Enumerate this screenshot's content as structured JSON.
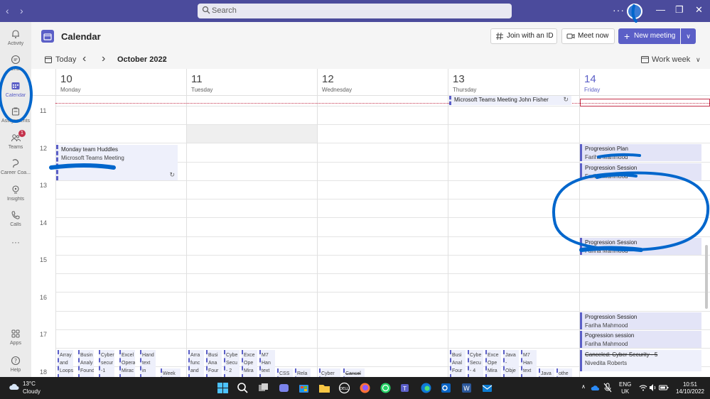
{
  "titlebar": {
    "search_placeholder": "Search",
    "more": "···"
  },
  "rail": [
    {
      "label": "Activity",
      "icon": "bell-icon",
      "active": false
    },
    {
      "label": "Chat",
      "icon": "chat-icon",
      "active": false
    },
    {
      "label": "Calendar",
      "icon": "calendar-icon",
      "active": true
    },
    {
      "label": "Assignments",
      "icon": "assignments-icon",
      "active": false
    },
    {
      "label": "Teams",
      "icon": "teams-icon",
      "active": false,
      "badge": "1"
    },
    {
      "label": "Career Coa...",
      "icon": "career-coach-icon",
      "active": false
    },
    {
      "label": "Insights",
      "icon": "insights-icon",
      "active": false
    },
    {
      "label": "Calls",
      "icon": "phone-icon",
      "active": false
    },
    {
      "label": "···",
      "icon": "more-icon",
      "active": false
    },
    {
      "label": "Apps",
      "icon": "apps-icon",
      "active": false
    },
    {
      "label": "Help",
      "icon": "help-icon",
      "active": false
    }
  ],
  "header": {
    "title": "Calendar",
    "join_id": "Join with an ID",
    "meet_now": "Meet now",
    "new_meeting": "New meeting"
  },
  "toolbar": {
    "today": "Today",
    "month": "October 2022",
    "view": "Work week"
  },
  "days": [
    {
      "num": "10",
      "name": "Monday"
    },
    {
      "num": "11",
      "name": "Tuesday"
    },
    {
      "num": "12",
      "name": "Wednesday"
    },
    {
      "num": "13",
      "name": "Thursday"
    },
    {
      "num": "14",
      "name": "Friday"
    }
  ],
  "hours": [
    "11",
    "12",
    "13",
    "14",
    "15",
    "16",
    "17",
    "18"
  ],
  "events": {
    "thu_teams": {
      "title": "Microsoft Teams Meeting  John Fisher"
    },
    "mon_huddle": {
      "title": "Monday team Huddles",
      "sub": "Microsoft Teams Meeting"
    },
    "fri_plan": {
      "title": "Progression Plan",
      "sub": "Fariha Mahmood"
    },
    "fri_session1": {
      "title": "Progression Session",
      "sub": "Fariha Mahmood"
    },
    "fri_session2": {
      "title": "Progression Session",
      "sub": "Fariha Mahmood"
    },
    "fri_session3": {
      "title": "Progression Session",
      "sub": "Fariha Mahmood"
    },
    "fri_pogression": {
      "title": "Pogression session",
      "sub": "Fariha Mahmood"
    },
    "fri_cancel": {
      "title": "Canceled: Cyber Security - 5",
      "sub": "Nivedita Roberts"
    }
  },
  "mini_events": {
    "mon": [
      "Array and Loops",
      "Busin Analy Found",
      "Cyber secur -1",
      "Excel Opera Mirac",
      "Hand text in",
      "Week"
    ],
    "tue": [
      "Arra func and",
      "Busi Ana Four",
      "Cybe Secu - 2",
      "Exce Ope Mira",
      "M7 Han text",
      "CSS",
      "Rela"
    ],
    "wed": [
      "Cyber",
      "Cancel"
    ],
    "thu": [
      "Busi Anal Four",
      "Cybe Secu - 4",
      "Exce Ope Mira",
      "Java - Obje",
      "M7 Han text",
      "Java",
      "othe"
    ]
  },
  "taskbar": {
    "temp": "13°C",
    "weather": "Cloudy",
    "lang1": "ENG",
    "lang2": "UK",
    "time": "10:51",
    "date": "14/10/2022"
  }
}
